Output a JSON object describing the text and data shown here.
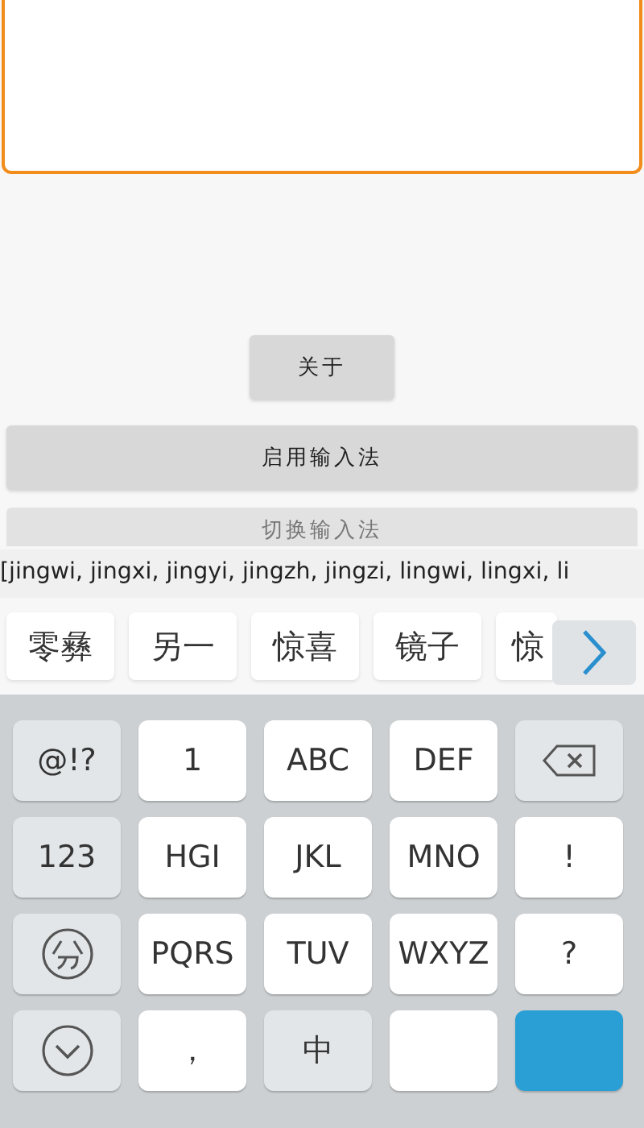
{
  "text_area": {
    "kind": "multiline"
  },
  "buttons": [
    {
      "label": "关于",
      "kind": "small",
      "disabled": false
    },
    {
      "label": "启用输入法",
      "kind": "wide",
      "disabled": false
    },
    {
      "label": "切换输入法",
      "kind": "wide",
      "disabled": true
    }
  ],
  "composition": "[jingwi, jingxi, jingyi, jingzh, jingzi, lingwi, lingxi, li",
  "candidates": [
    "零彝",
    "另一",
    "惊喜",
    "镜子",
    "惊"
  ],
  "keyboard": {
    "rows": [
      [
        {
          "kind": "func",
          "label": "@!?"
        },
        {
          "kind": "char",
          "label": "1"
        },
        {
          "kind": "char",
          "label": "ABC"
        },
        {
          "kind": "char",
          "label": "DEF"
        },
        {
          "kind": "backspace"
        }
      ],
      [
        {
          "kind": "func",
          "label": "123"
        },
        {
          "kind": "char",
          "label": "HGI"
        },
        {
          "kind": "char",
          "label": "JKL"
        },
        {
          "kind": "char",
          "label": "MNO"
        },
        {
          "kind": "char",
          "label": "!"
        }
      ],
      [
        {
          "kind": "fen"
        },
        {
          "kind": "char",
          "label": "PQRS"
        },
        {
          "kind": "char",
          "label": "TUV"
        },
        {
          "kind": "char",
          "label": "WXYZ"
        },
        {
          "kind": "char",
          "label": "?"
        }
      ],
      [
        {
          "kind": "hide"
        },
        {
          "kind": "char",
          "label": "，"
        },
        {
          "kind": "func",
          "label": "中"
        },
        {
          "kind": "space"
        },
        {
          "kind": "enter"
        }
      ]
    ]
  }
}
